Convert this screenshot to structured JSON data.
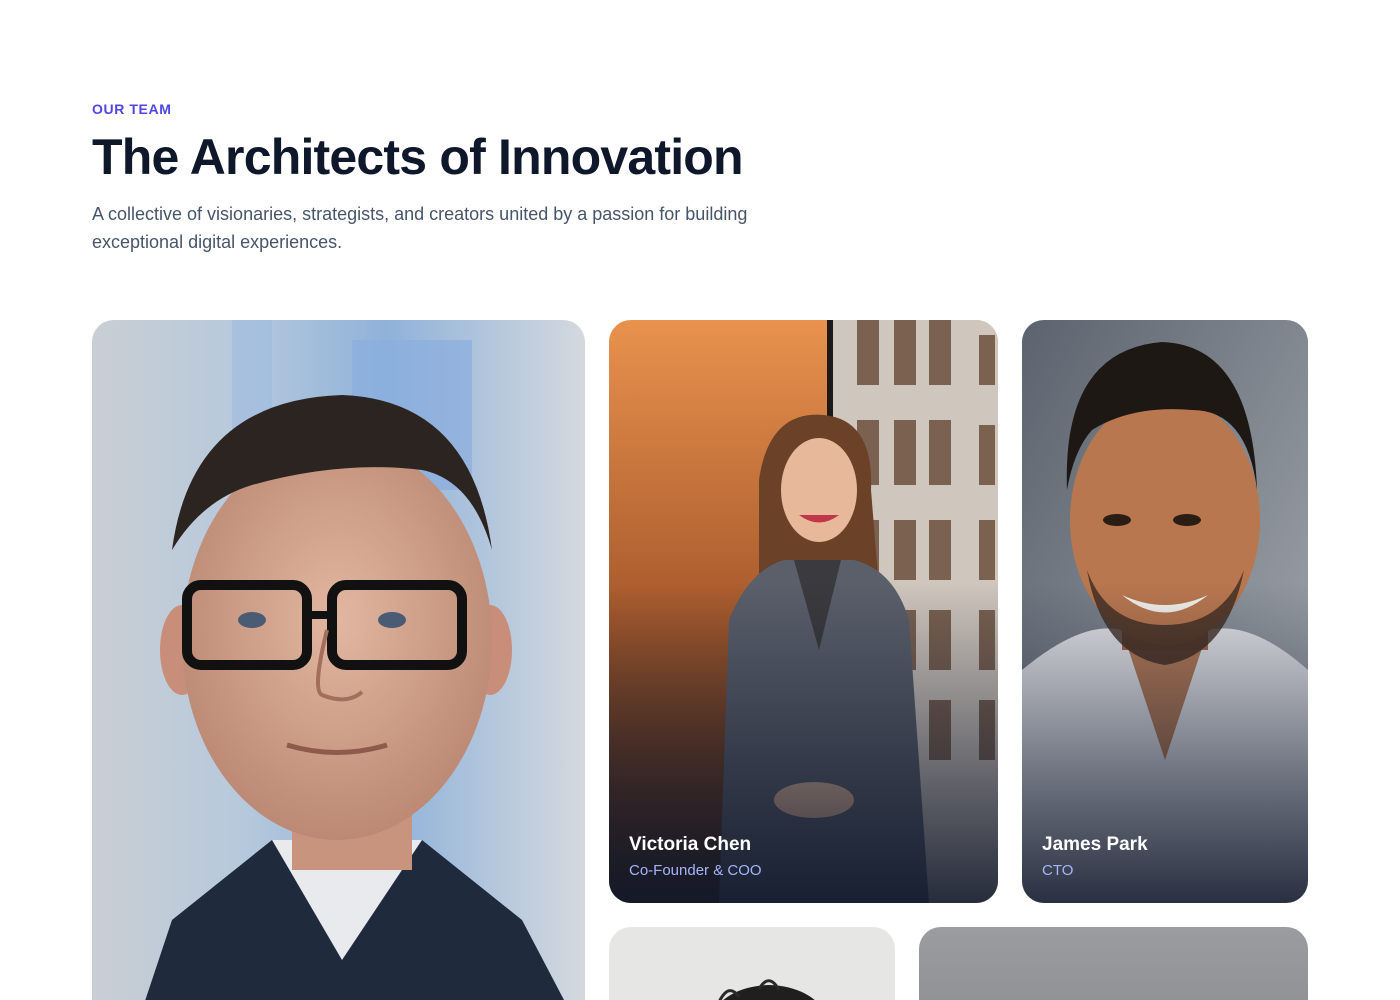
{
  "section": {
    "eyebrow": "OUR TEAM",
    "title": "The Architects of Innovation",
    "subtitle": "A collective of visionaries, strategists, and creators united by a passion for building exceptional digital experiences."
  },
  "members": [
    {
      "name": "",
      "role": ""
    },
    {
      "name": "Victoria Chen",
      "role": "Co-Founder & COO"
    },
    {
      "name": "James Park",
      "role": "CTO"
    },
    {
      "name": "",
      "role": ""
    },
    {
      "name": "",
      "role": ""
    }
  ],
  "colors": {
    "accent": "#4f46e5",
    "role_text": "#a5b4fc",
    "heading": "#0f172a",
    "body_text": "#475569"
  }
}
